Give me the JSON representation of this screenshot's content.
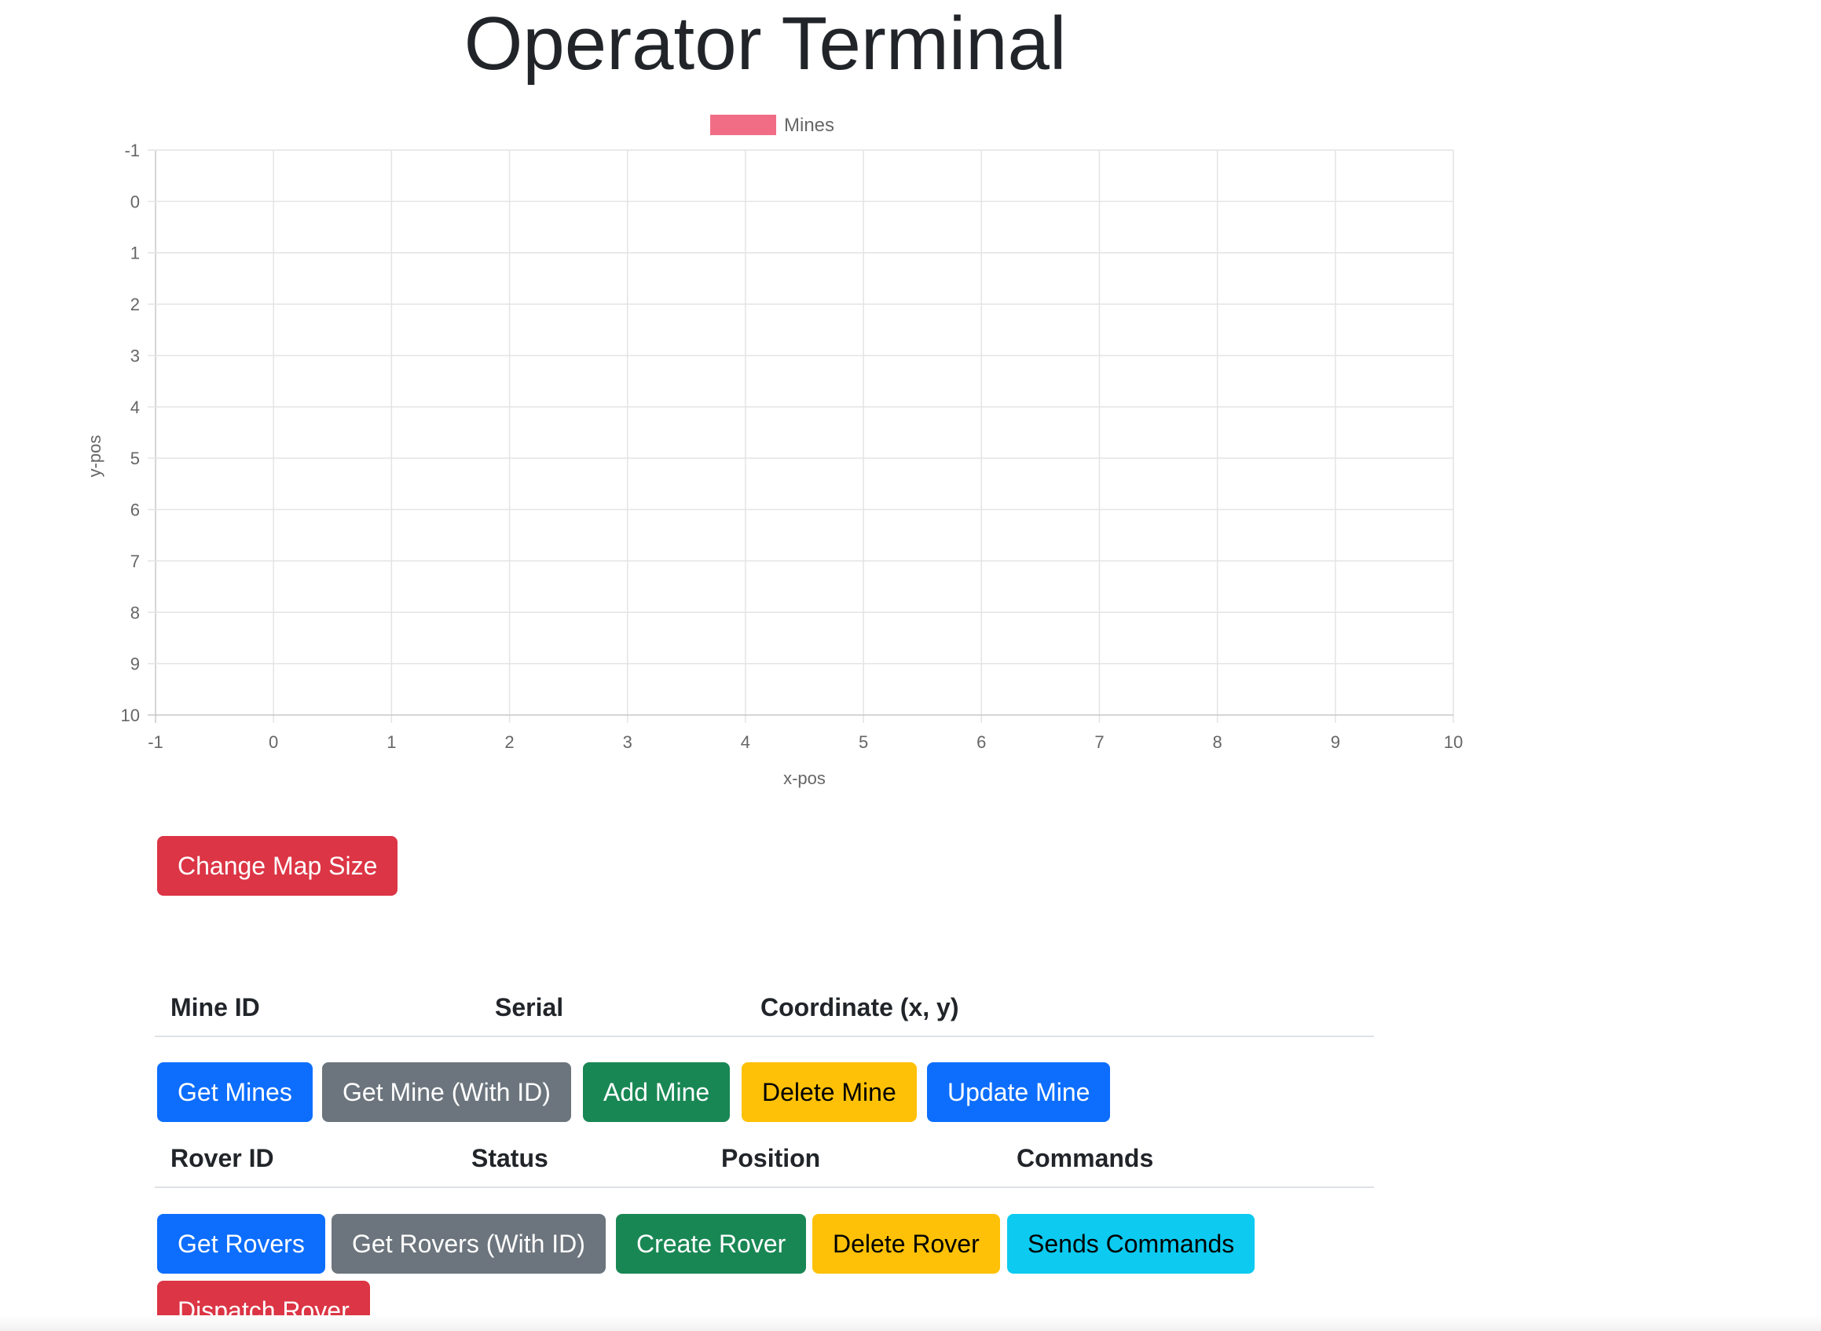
{
  "page": {
    "title": "Operator Terminal"
  },
  "chart_data": {
    "type": "scatter",
    "legend": {
      "label": "Mines",
      "color": "#f06d85",
      "placement": "top"
    },
    "xlabel": "x-pos",
    "ylabel": "y-pos",
    "xlim": [
      -1,
      10
    ],
    "ylim": [
      -1,
      10
    ],
    "y_inverted": true,
    "x_ticks": [
      "-1",
      "0",
      "1",
      "2",
      "3",
      "4",
      "5",
      "6",
      "7",
      "8",
      "9",
      "10"
    ],
    "y_ticks": [
      "-1",
      "0",
      "1",
      "2",
      "3",
      "4",
      "5",
      "6",
      "7",
      "8",
      "9",
      "10"
    ],
    "grid": true,
    "series": [
      {
        "name": "Mines",
        "points": []
      }
    ]
  },
  "map_controls": {
    "change_map_size": "Change Map Size"
  },
  "mines_table": {
    "headers": [
      "Mine ID",
      "Serial",
      "Coordinate (x, y)"
    ],
    "buttons": {
      "get_mines": "Get Mines",
      "get_mine_with_id": "Get Mine (With ID)",
      "add_mine": "Add Mine",
      "delete_mine": "Delete Mine",
      "update_mine": "Update Mine"
    }
  },
  "rovers_table": {
    "headers": [
      "Rover ID",
      "Status",
      "Position",
      "Commands"
    ],
    "buttons": {
      "get_rovers": "Get Rovers",
      "get_rovers_with_id": "Get Rovers (With ID)",
      "create_rover": "Create Rover",
      "delete_rover": "Delete Rover",
      "sends_commands": "Sends Commands",
      "dispatch_rover": "Dispatch Rover"
    }
  }
}
